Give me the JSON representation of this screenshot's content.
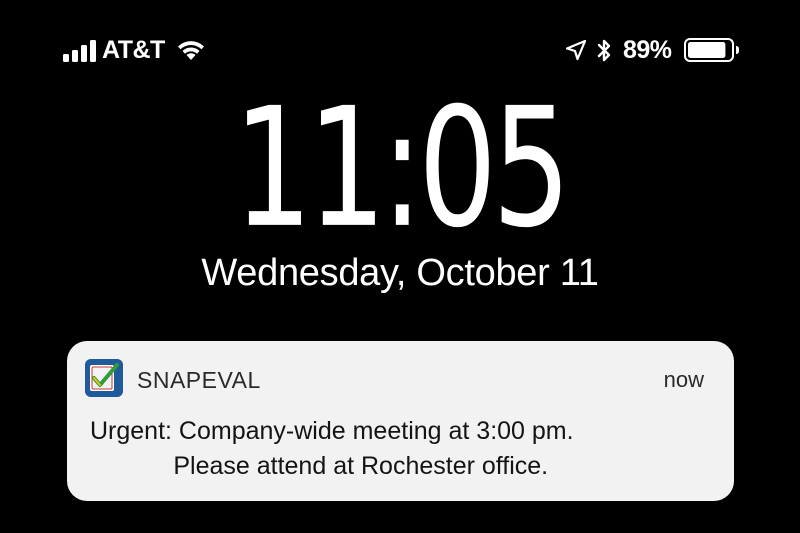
{
  "status_bar": {
    "carrier": "AT&T",
    "signal_bars": 4,
    "battery_percent": "89%",
    "battery_level": 0.89,
    "icons": [
      "signal-icon",
      "wifi-icon",
      "location-arrow-icon",
      "bluetooth-icon",
      "battery-icon"
    ]
  },
  "lock_screen": {
    "time": "11:05",
    "date": "Wednesday, October 11"
  },
  "notification": {
    "app_name": "SNAPEVAL",
    "app_icon": "snapeval-checkmark-icon",
    "time": "now",
    "body_line_1": "Urgent: Company-wide meeting at 3:00 pm.",
    "body_line_2": "            Please attend at Rochester office."
  },
  "colors": {
    "background": "#000000",
    "text": "#ffffff",
    "notification_bg": "#f2f2f2",
    "app_icon_bg": "#1f5b9a"
  }
}
